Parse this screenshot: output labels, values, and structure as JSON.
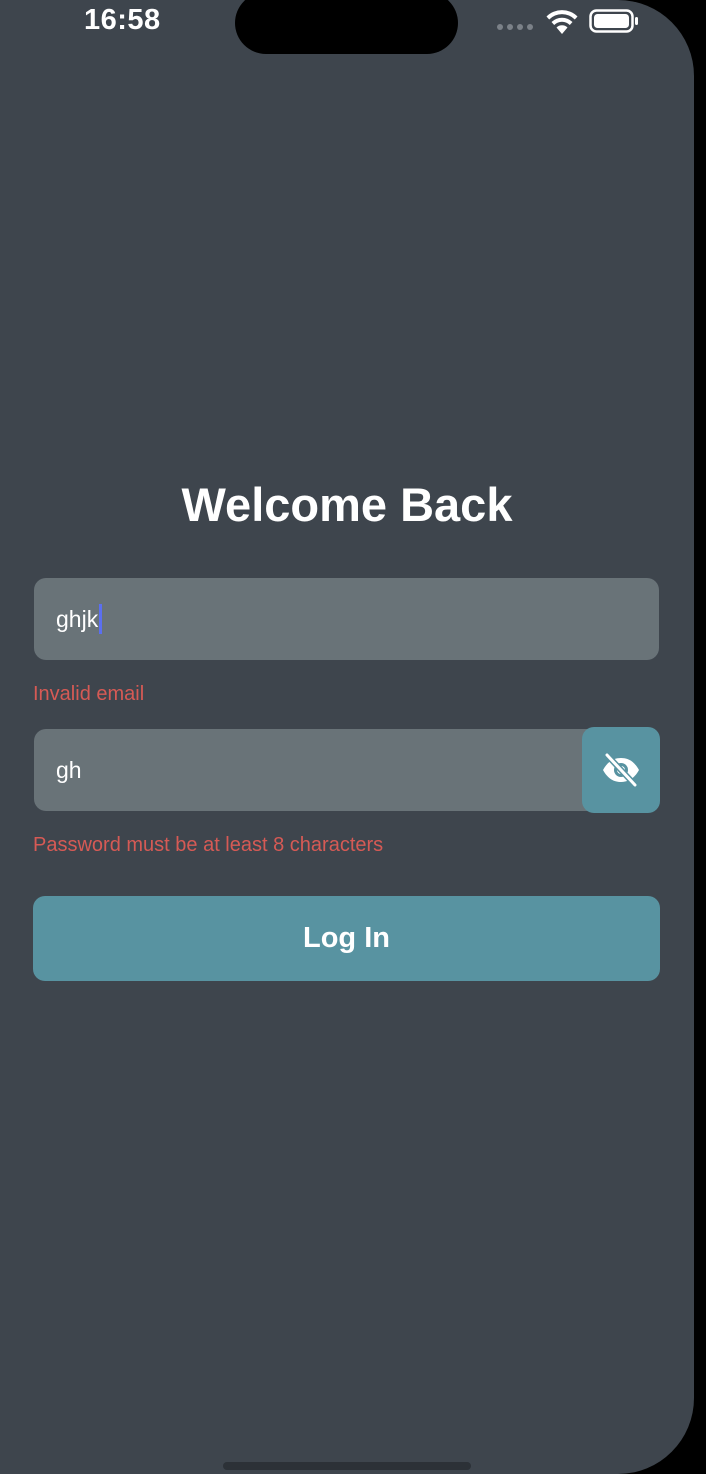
{
  "status_bar": {
    "time": "16:58"
  },
  "login": {
    "title": "Welcome Back",
    "email_value": "ghjk",
    "email_error": "Invalid email",
    "password_value": "gh",
    "password_error": "Password must be at least 8 characters",
    "login_button_label": "Log In"
  },
  "icons": {
    "visibility_toggle": "eye-off-icon",
    "wifi": "wifi-icon",
    "battery": "battery-icon",
    "signal": "signal-dots-icon"
  },
  "colors": {
    "background": "#3e454d",
    "field": "#697378",
    "accent": "#5893a1",
    "error": "#d65a55",
    "caret": "#5b6ff0"
  }
}
